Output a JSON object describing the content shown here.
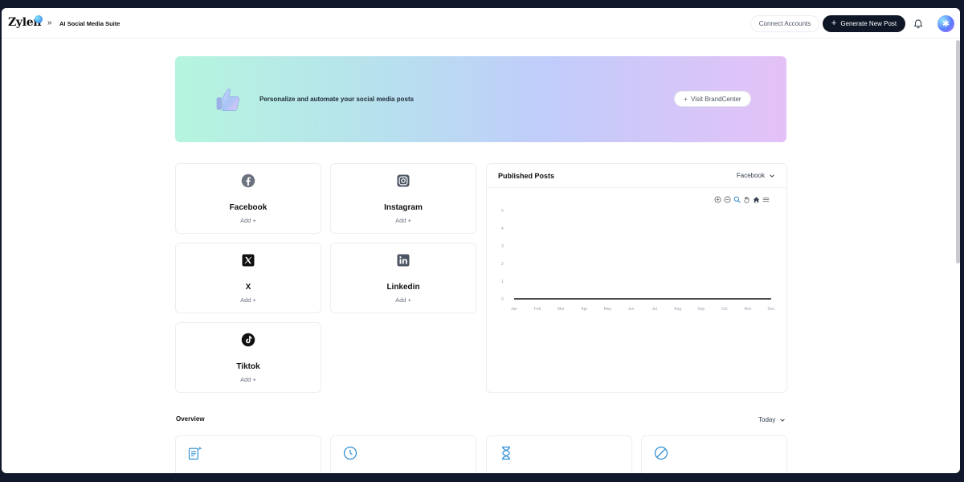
{
  "header": {
    "logo": "Zylen",
    "breadcrumb_separator": "»",
    "breadcrumb": "AI Social Media Suite",
    "connect_label": "Connect Accounts",
    "generate_label": "Generate New Post",
    "generate_icon": "+"
  },
  "banner": {
    "text": "Personalize and automate your social media posts",
    "button_label": "Visit BrandCenter",
    "button_icon": "+"
  },
  "platforms": [
    {
      "name": "Facebook",
      "add": "Add +",
      "icon": "facebook-icon"
    },
    {
      "name": "Instagram",
      "add": "Add +",
      "icon": "instagram-icon"
    },
    {
      "name": "X",
      "add": "Add +",
      "icon": "x-icon"
    },
    {
      "name": "Linkedin",
      "add": "Add +",
      "icon": "linkedin-icon"
    },
    {
      "name": "Tiktok",
      "add": "Add +",
      "icon": "tiktok-icon"
    }
  ],
  "published": {
    "title": "Published Posts",
    "selected_platform": "Facebook"
  },
  "overview": {
    "title": "Overview",
    "range": "Today"
  },
  "colors": {
    "primary_dark": "#0f1626",
    "banner_start": "#b5f5de",
    "banner_end": "#e4c1f7",
    "accent_icon": "#2f8fd6"
  },
  "chart_data": {
    "type": "line",
    "categories": [
      "Jan",
      "Feb",
      "Mar",
      "Apr",
      "May",
      "Jun",
      "Jul",
      "Aug",
      "Sep",
      "Oct",
      "Nov",
      "Dec"
    ],
    "series": [
      {
        "values": [
          0,
          0,
          0,
          0,
          0,
          0,
          0,
          0,
          0,
          0,
          0,
          0
        ]
      }
    ],
    "yticks": [
      0,
      1,
      2,
      3,
      4,
      5
    ],
    "ylim": [
      0,
      5
    ],
    "grid": false
  }
}
